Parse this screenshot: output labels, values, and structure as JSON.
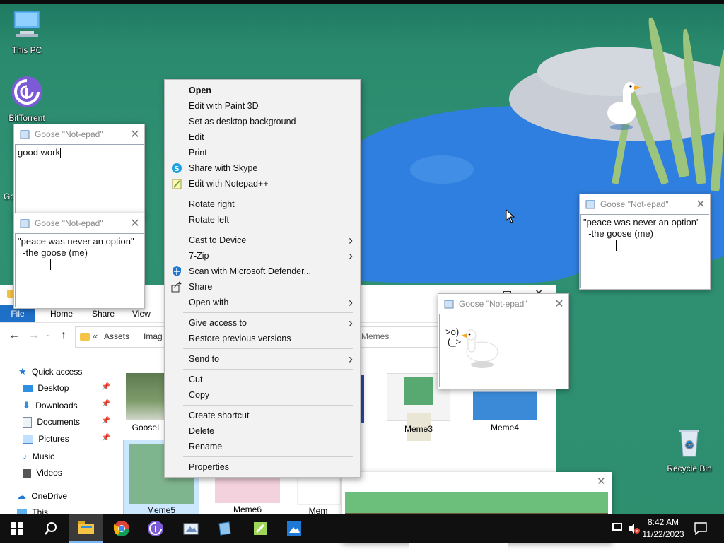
{
  "desktop": {
    "icons": [
      {
        "label": "This PC"
      },
      {
        "label": "BitTorrent"
      },
      {
        "label": "Recycle Bin"
      }
    ],
    "hidden_icon_fragment": "Go"
  },
  "notepads": [
    {
      "title": "Goose \"Not-epad\"",
      "lines": [
        "good work"
      ]
    },
    {
      "title": "Goose \"Not-epad\"",
      "lines": [
        "\"peace was never an option\"",
        "  -the goose (me)"
      ]
    },
    {
      "title": "Goose \"Not-epad\"",
      "lines": [
        "\"peace was never an option\"",
        "  -the goose (me)"
      ]
    },
    {
      "title": "Goose \"Not-epad\"",
      "lines": [
        ">o)",
        "(_>"
      ]
    }
  ],
  "explorer": {
    "ribbon_tabs": [
      "File",
      "Home",
      "Share",
      "View"
    ],
    "address": {
      "prefix": "«",
      "crumbs": [
        "Assets",
        "Imag"
      ],
      "tail": "Memes"
    },
    "nav": [
      {
        "label": "Quick access",
        "icon": "star-icon",
        "pinned": false
      },
      {
        "label": "Desktop",
        "icon": "desktop-folder-icon",
        "pinned": true
      },
      {
        "label": "Downloads",
        "icon": "download-icon",
        "pinned": true
      },
      {
        "label": "Documents",
        "icon": "document-icon",
        "pinned": true
      },
      {
        "label": "Pictures",
        "icon": "picture-icon",
        "pinned": true
      },
      {
        "label": "Music",
        "icon": "music-icon",
        "pinned": false
      },
      {
        "label": "Videos",
        "icon": "video-icon",
        "pinned": false
      },
      {
        "label": "OneDrive",
        "icon": "cloud-icon",
        "pinned": false
      },
      {
        "label": "This",
        "icon": "pc-icon",
        "pinned": false
      }
    ],
    "files": [
      {
        "label": "GooseI"
      },
      {
        "label": "Meme3"
      },
      {
        "label": "Meme4"
      },
      {
        "label": "Meme5"
      },
      {
        "label": "Meme6"
      },
      {
        "label": "Mem"
      }
    ]
  },
  "context_menu": {
    "items": [
      {
        "label": "Open",
        "bold": true
      },
      {
        "label": "Edit with Paint 3D"
      },
      {
        "label": "Set as desktop background"
      },
      {
        "label": "Edit"
      },
      {
        "label": "Print"
      },
      {
        "label": "Share with Skype",
        "icon": "skype-icon"
      },
      {
        "label": "Edit with Notepad++",
        "icon": "notepad-plus-icon"
      },
      {
        "separator": true
      },
      {
        "label": "Rotate right"
      },
      {
        "label": "Rotate left"
      },
      {
        "separator": true
      },
      {
        "label": "Cast to Device",
        "submenu": true
      },
      {
        "label": "7-Zip",
        "submenu": true
      },
      {
        "label": "Scan with Microsoft Defender...",
        "icon": "defender-icon"
      },
      {
        "label": "Share",
        "icon": "share-icon"
      },
      {
        "label": "Open with",
        "submenu": true
      },
      {
        "separator": true
      },
      {
        "label": "Give access to",
        "submenu": true
      },
      {
        "label": "Restore previous versions"
      },
      {
        "separator": true
      },
      {
        "label": "Send to",
        "submenu": true
      },
      {
        "separator": true
      },
      {
        "label": "Cut"
      },
      {
        "label": "Copy"
      },
      {
        "separator": true
      },
      {
        "label": "Create shortcut"
      },
      {
        "label": "Delete"
      },
      {
        "label": "Rename"
      },
      {
        "separator": true
      },
      {
        "label": "Properties"
      }
    ]
  },
  "taskbar": {
    "apps": [
      "start-icon",
      "search-icon",
      "file-explorer-icon",
      "chrome-icon",
      "bittorrent-icon",
      "paint-icon",
      "notepad-icon",
      "notepad-plus-icon",
      "photos-icon"
    ],
    "time": "8:42 AM",
    "date": "11/22/2023"
  },
  "colors": {
    "accent": "#0078d4",
    "pond": "#2f7fe0",
    "grass": "#2e8f6f",
    "taskbar": "#101010"
  }
}
